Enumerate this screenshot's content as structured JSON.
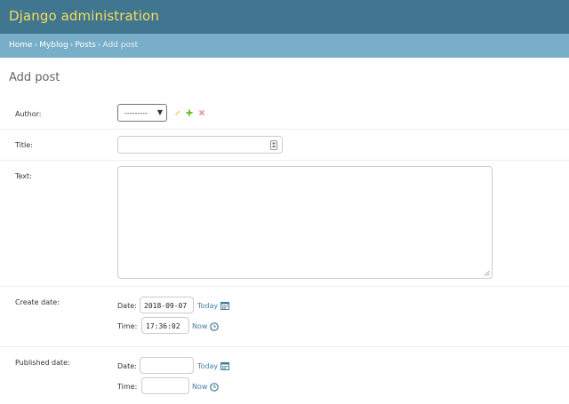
{
  "header": {
    "brand": "Django administration"
  },
  "breadcrumbs": {
    "home": "Home",
    "app": "Myblog",
    "model": "Posts",
    "current": "Add post",
    "sep": "›"
  },
  "page": {
    "title": "Add post"
  },
  "form": {
    "author": {
      "label": "Author:",
      "selected": "---------"
    },
    "title": {
      "label": "Title:",
      "value": ""
    },
    "text": {
      "label": "Text:",
      "value": ""
    },
    "create_date": {
      "label": "Create date:",
      "date_label": "Date:",
      "date_value": "2018-09-07",
      "today_link": "Today",
      "time_label": "Time:",
      "time_value": "17:36:02",
      "now_link": "Now"
    },
    "published_date": {
      "label": "Published date:",
      "date_label": "Date:",
      "date_value": "",
      "today_link": "Today",
      "time_label": "Time:",
      "time_value": "",
      "now_link": "Now"
    }
  },
  "colors": {
    "header_bg": "#417690",
    "brand": "#f5dd5d",
    "breadcrumb_bg": "#79aec8",
    "link": "#447e9b"
  },
  "icons": {
    "edit": "pencil-icon",
    "add": "plus-icon",
    "delete": "x-icon",
    "calendar": "calendar-icon",
    "clock": "clock-icon",
    "key": "key-icon"
  }
}
